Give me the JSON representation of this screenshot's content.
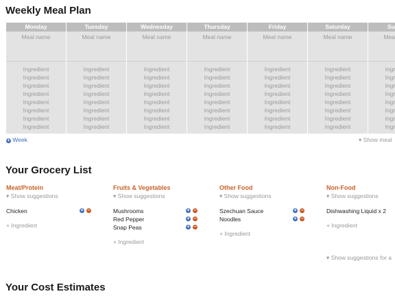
{
  "meal_plan": {
    "title": "Weekly Meal Plan",
    "days": [
      "Monday",
      "Tuesday",
      "Wednesday",
      "Thursday",
      "Friday",
      "Saturday",
      "Sunday"
    ],
    "meal_placeholder": "Meal name",
    "ingredient_placeholder": "Ingredient",
    "add_week": "Week",
    "show_meal": "Show meal"
  },
  "grocery": {
    "title": "Your Grocery List",
    "show_suggestions": "Show suggestions",
    "add_ingredient": "Ingredient",
    "show_suggestions_all": "Show suggestions for a",
    "categories": [
      {
        "name": "Meat/Protein",
        "items": [
          "Chicken"
        ]
      },
      {
        "name": "Fruits & Vegetables",
        "items": [
          "Mushrooms",
          "Red Pepper",
          "Snap Peas"
        ]
      },
      {
        "name": "Other Food",
        "items": [
          "Szechuan Sauce",
          "Noodles"
        ]
      },
      {
        "name": "Non-Food",
        "items": [
          "Dishwashing Liquid x 2"
        ]
      }
    ]
  },
  "cost": {
    "title": "Your Cost Estimates"
  }
}
